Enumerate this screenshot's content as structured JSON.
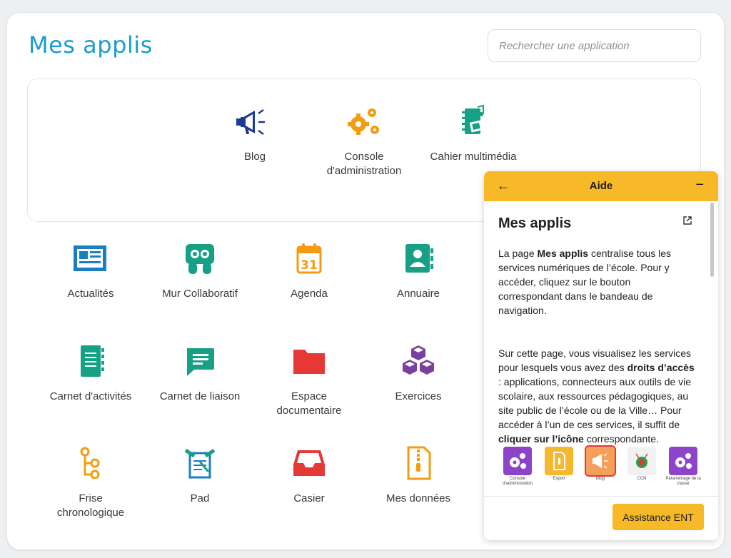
{
  "page": {
    "title": "Mes applis"
  },
  "search": {
    "placeholder": "Rechercher une application"
  },
  "favorites": [
    {
      "label": "Blog",
      "icon": "megaphone-icon"
    },
    {
      "label": "Console d'administration",
      "icon": "gears-icon"
    },
    {
      "label": "Cahier multimédia",
      "icon": "multimedia-notebook-icon"
    }
  ],
  "apps": [
    {
      "label": "Actualités",
      "icon": "newspaper-icon"
    },
    {
      "label": "Mur Collaboratif",
      "icon": "collaborative-wall-icon"
    },
    {
      "label": "Agenda",
      "icon": "calendar-icon"
    },
    {
      "label": "Annuaire",
      "icon": "contacts-book-icon"
    },
    {
      "label": "Carnet d'activités",
      "icon": "activity-notebook-icon"
    },
    {
      "label": "Carnet de liaison",
      "icon": "chat-bubble-icon"
    },
    {
      "label": "Espace documentaire",
      "icon": "folder-icon"
    },
    {
      "label": "Exercices",
      "icon": "cubes-icon"
    },
    {
      "label": "Frise chronologique",
      "icon": "timeline-icon"
    },
    {
      "label": "Pad",
      "icon": "pad-icon"
    },
    {
      "label": "Casier",
      "icon": "inbox-tray-icon"
    },
    {
      "label": "Mes données",
      "icon": "zip-file-icon"
    }
  ],
  "help": {
    "header_title": "Aide",
    "back_glyph": "←",
    "minimize_glyph": "−",
    "heading": "Mes applis",
    "p1_before": "La page ",
    "p1_bold": "Mes applis",
    "p1_after": " centralise tous les services numériques de l’école. Pour y accéder, cliquez sur le bouton correspondant dans le bandeau de navigation.",
    "p2_before": "Sur cette page, vous visualisez les services pour lesquels vous avez des ",
    "p2_bold1": "droits d’accès",
    "p2_mid": " : applications, connecteurs aux outils de vie scolaire, aux ressources pédagogiques, au site public de l’école ou de la Ville… Pour accéder à l’un de ces services, il suffit de ",
    "p2_bold2": "cliquer sur l’icône",
    "p2_after": " correspondante.",
    "thumbnails": [
      {
        "label": "Console d'administration",
        "color": "#8e44c9"
      },
      {
        "label": "Export",
        "color": "#f5b82e"
      },
      {
        "label": "Blog",
        "color": "#f5a05a"
      },
      {
        "label": "CCN",
        "color": "#f1f1f1"
      },
      {
        "label": "Paramétrage de la classe",
        "color": "#8e44c9"
      }
    ],
    "button_label": "Assistance ENT"
  },
  "colors": {
    "title": "#1a9dcf",
    "help_accent": "#f8b928",
    "navy": "#1f3a93",
    "orange": "#f39c12",
    "teal": "#16a085",
    "red": "#e53935",
    "purple": "#7b3fa0"
  }
}
